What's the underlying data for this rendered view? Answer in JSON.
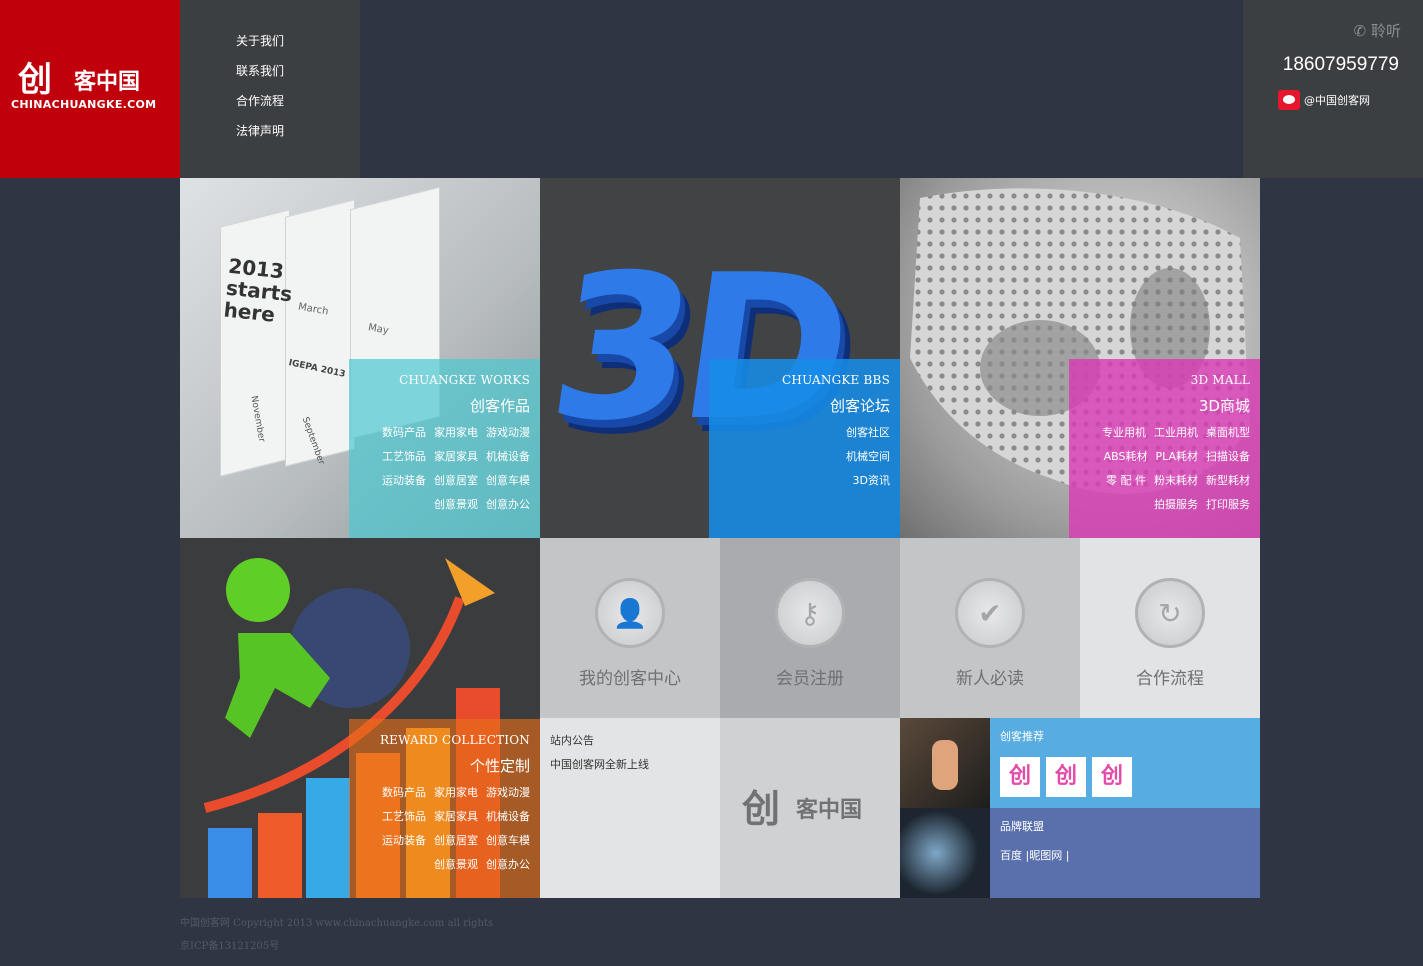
{
  "header": {
    "logo": {
      "mark": "创",
      "cn": "客中国",
      "en": "CHINACHUANGKE.COM"
    },
    "nav": [
      "关于我们",
      "联系我们",
      "合作流程",
      "法律声明"
    ],
    "listen_label": "✆ 聆听",
    "phone": "18607959779",
    "weibo": "@中国创客网"
  },
  "works": {
    "en": "CHUANGKE WORKS",
    "title": "创客作品",
    "rows": [
      [
        "数码产品",
        "家用家电",
        "游戏动漫"
      ],
      [
        "工艺饰品",
        "家居家具",
        "机械设备"
      ],
      [
        "运动装备",
        "创意居室",
        "创意车模"
      ],
      [
        "创意景观",
        "创意办公"
      ]
    ],
    "image_text": {
      "year": "2013",
      "line2": "starts",
      "line3": "here",
      "march": "March",
      "may": "May",
      "igepa": "IGEPA 2013",
      "nov": "November",
      "sep": "September"
    }
  },
  "bbs": {
    "glyph": "3D",
    "en": "CHUANGKE BBS",
    "title": "创客论坛",
    "rows": [
      [
        "创客社区"
      ],
      [
        "机械空间"
      ],
      [
        "3D资讯"
      ]
    ]
  },
  "mall": {
    "en": "3D MALL",
    "title": "3D商城",
    "rows": [
      [
        "专业用机",
        "工业用机",
        "桌面机型"
      ],
      [
        "ABS耗材",
        "PLA耗材",
        "扫描设备"
      ],
      [
        "零 配 件",
        "粉末耗材",
        "新型耗材"
      ],
      [
        "拍摄服务",
        "打印服务"
      ]
    ]
  },
  "reward": {
    "en": "REWARD COLLECTION",
    "title": "个性定制",
    "rows": [
      [
        "数码产品",
        "家用家电",
        "游戏动漫"
      ],
      [
        "工艺饰品",
        "家居家具",
        "机械设备"
      ],
      [
        "运动装备",
        "创意居室",
        "创意车模"
      ],
      [
        "创意景观",
        "创意办公"
      ]
    ]
  },
  "quick": [
    {
      "label": "我的创客中心",
      "icon": "user-icon",
      "glyph": "👤",
      "bg": "#c3c5c7"
    },
    {
      "label": "会员注册",
      "icon": "key-icon",
      "glyph": "⚷",
      "bg": "#a9abaf"
    },
    {
      "label": "新人必读",
      "icon": "check-icon",
      "glyph": "✔",
      "bg": "#c3c5c7"
    },
    {
      "label": "合作流程",
      "icon": "return-icon",
      "glyph": "↻",
      "bg": "#e2e3e4"
    }
  ],
  "notice": {
    "title": "站内公告",
    "item": "中国创客网全新上线"
  },
  "brand_logo": {
    "mark": "创",
    "cn": "客中国"
  },
  "recommend": {
    "title": "创客推荐",
    "items": [
      "创",
      "创",
      "创"
    ],
    "bg": "#57ace2"
  },
  "alliance": {
    "title": "品牌联盟",
    "links": "百度 |昵图网 |",
    "bg": "#5a70ad"
  },
  "footer": {
    "line1": "中国创客网 Copyright 2013 www.chinachuangke.com all rights",
    "line2": "京ICP备13121205号"
  }
}
